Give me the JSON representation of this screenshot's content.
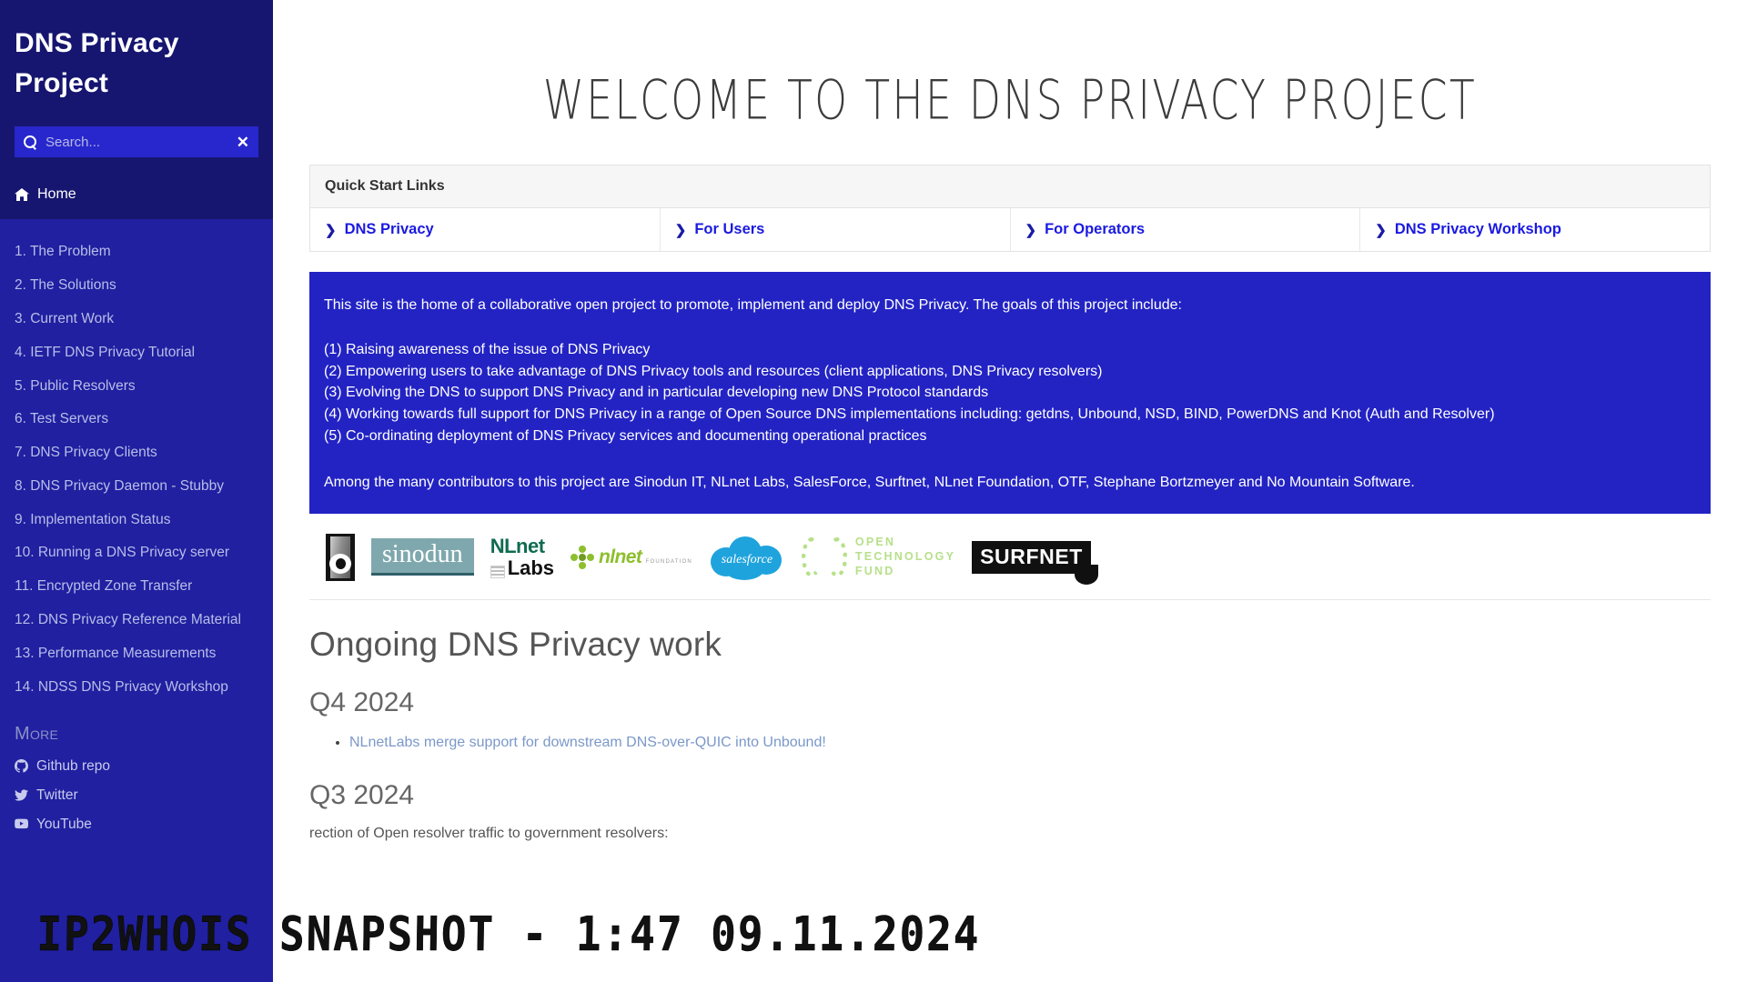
{
  "sidebar": {
    "title": "DNS Privacy Project",
    "search": {
      "placeholder": "Search...",
      "value": "",
      "clear_label": "✕"
    },
    "home_label": "Home",
    "nav_items": [
      {
        "label": "1. The Problem"
      },
      {
        "label": "2. The Solutions"
      },
      {
        "label": "3. Current Work"
      },
      {
        "label": "4. IETF DNS Privacy Tutorial"
      },
      {
        "label": "5. Public Resolvers"
      },
      {
        "label": "6. Test Servers"
      },
      {
        "label": "7. DNS Privacy Clients"
      },
      {
        "label": "8. DNS Privacy Daemon - Stubby"
      },
      {
        "label": "9. Implementation Status"
      },
      {
        "label": "10. Running a DNS Privacy server"
      },
      {
        "label": "11. Encrypted Zone Transfer"
      },
      {
        "label": "12. DNS Privacy Reference Material"
      },
      {
        "label": "13. Performance Measurements"
      },
      {
        "label": "14. NDSS DNS Privacy Workshop"
      }
    ],
    "more_heading": "More",
    "social": [
      {
        "label": "Github repo",
        "icon": "github-icon"
      },
      {
        "label": "Twitter",
        "icon": "twitter-icon"
      },
      {
        "label": "YouTube",
        "icon": "youtube-icon"
      }
    ]
  },
  "main": {
    "page_title": "WELCOME TO THE DNS PRIVACY PROJECT",
    "quick_start": {
      "heading": "Quick Start Links",
      "links": [
        {
          "label": "DNS Privacy"
        },
        {
          "label": "For Users"
        },
        {
          "label": "For Operators"
        },
        {
          "label": "DNS Privacy Workshop"
        }
      ]
    },
    "info_box": {
      "lead": "This site is the home of a collaborative open project to promote, implement and deploy DNS Privacy. The goals of this project include:",
      "goals": [
        "(1) Raising awareness of the issue of DNS Privacy",
        "(2) Empowering users to take advantage of DNS Privacy tools and resources (client applications, DNS Privacy resolvers)",
        "(3) Evolving the DNS to support DNS Privacy and in particular developing new DNS Protocol standards",
        "(4) Working towards full support for DNS Privacy in a range of Open Source DNS implementations including: getdns, Unbound, NSD, BIND, PowerDNS and Knot (Auth and Resolver)",
        "(5) Co-ordinating deployment of DNS Privacy services and documenting operational practices"
      ],
      "contributors": "Among the many contributors to this project are Sinodun IT, NLnet Labs, SalesForce, Surftnet, NLnet Foundation, OTF, Stephane Bortzmeyer and No Mountain Software."
    },
    "logos": [
      {
        "name": "sinodun-logo",
        "text": "sinodun"
      },
      {
        "name": "nlnet-labs-logo",
        "text_top": "NLnet",
        "text_bottom": "Labs"
      },
      {
        "name": "nlnet-foundation-logo",
        "text": "nlnet",
        "sub": "FOUNDATION"
      },
      {
        "name": "salesforce-logo",
        "text": "salesforce"
      },
      {
        "name": "open-technology-fund-logo",
        "line1": "OPEN",
        "line2": "TECHNOLOGY",
        "line3": "FUND"
      },
      {
        "name": "surfnet-logo",
        "text_a": "SURF",
        "text_b": "NET"
      }
    ],
    "section_heading": "Ongoing DNS Privacy work",
    "quarters": [
      {
        "label": "Q4 2024",
        "items": [
          {
            "text": "NLnetLabs merge support for downstream DNS-over-QUIC into Unbound!",
            "is_link": true
          }
        ]
      },
      {
        "label": "Q3 2024",
        "items": [
          {
            "text": "rection of Open resolver traffic to government resolvers:",
            "is_link": false
          }
        ]
      }
    ]
  },
  "watermark": {
    "text": "IP2WHOIS SNAPSHOT - 1:47 09.11.2024"
  },
  "colors": {
    "sidebar_bg": "#2020a0",
    "sidebar_head_bg": "#161670",
    "info_box_bg": "#2323c4",
    "link_blue": "#1a1ae0"
  }
}
